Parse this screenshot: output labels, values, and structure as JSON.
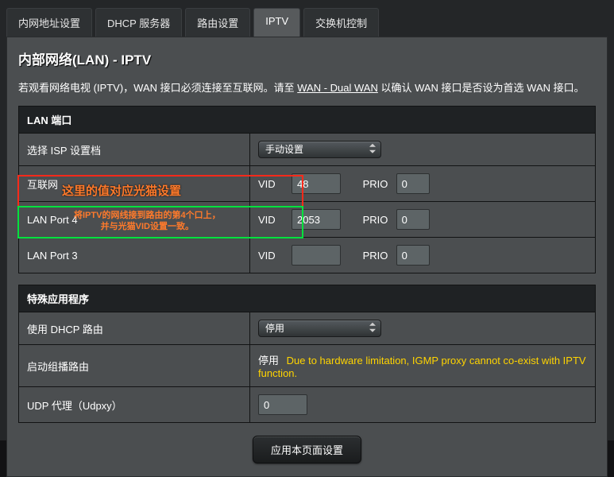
{
  "tabs": {
    "t0": "内网地址设置",
    "t1": "DHCP 服务器",
    "t2": "路由设置",
    "t3": "IPTV",
    "t4": "交换机控制"
  },
  "panel": {
    "title": "内部网络(LAN) - IPTV",
    "desc_pre": "若观看网络电视 (IPTV)，WAN 接口必须连接至互联网。请至 ",
    "desc_link": "WAN - Dual WAN",
    "desc_post": " 以确认 WAN 接口是否设为首选 WAN 接口。"
  },
  "section1": {
    "header": "LAN 端口",
    "isp_label": "选择 ISP 设置档",
    "isp_value": "手动设置",
    "row_internet": "互联网",
    "row_p4": "LAN Port 4",
    "row_p3": "LAN Port 3",
    "vid_label": "VID",
    "prio_label": "PRIO",
    "internet_vid": "48",
    "internet_prio": "0",
    "p4_vid": "2053",
    "p4_prio": "0",
    "p3_vid": "",
    "p3_prio": "0"
  },
  "section2": {
    "header": "特殊应用程序",
    "dhcp_label": "使用 DHCP 路由",
    "dhcp_value": "停用",
    "igmp_label": "启动组播路由",
    "igmp_value": "停用",
    "igmp_note": "Due to hardware limitation, IGMP proxy cannot co-exist with IPTV function.",
    "udp_label": "UDP 代理（Udpxy）",
    "udp_value": "0"
  },
  "apply": "应用本页面设置",
  "annot": {
    "red_text": "这里的值对应光猫设置",
    "green_text_l1": "将IPTV的网线接到路由的第4个口上，",
    "green_text_l2": "并与光猫VID设置一致。"
  }
}
